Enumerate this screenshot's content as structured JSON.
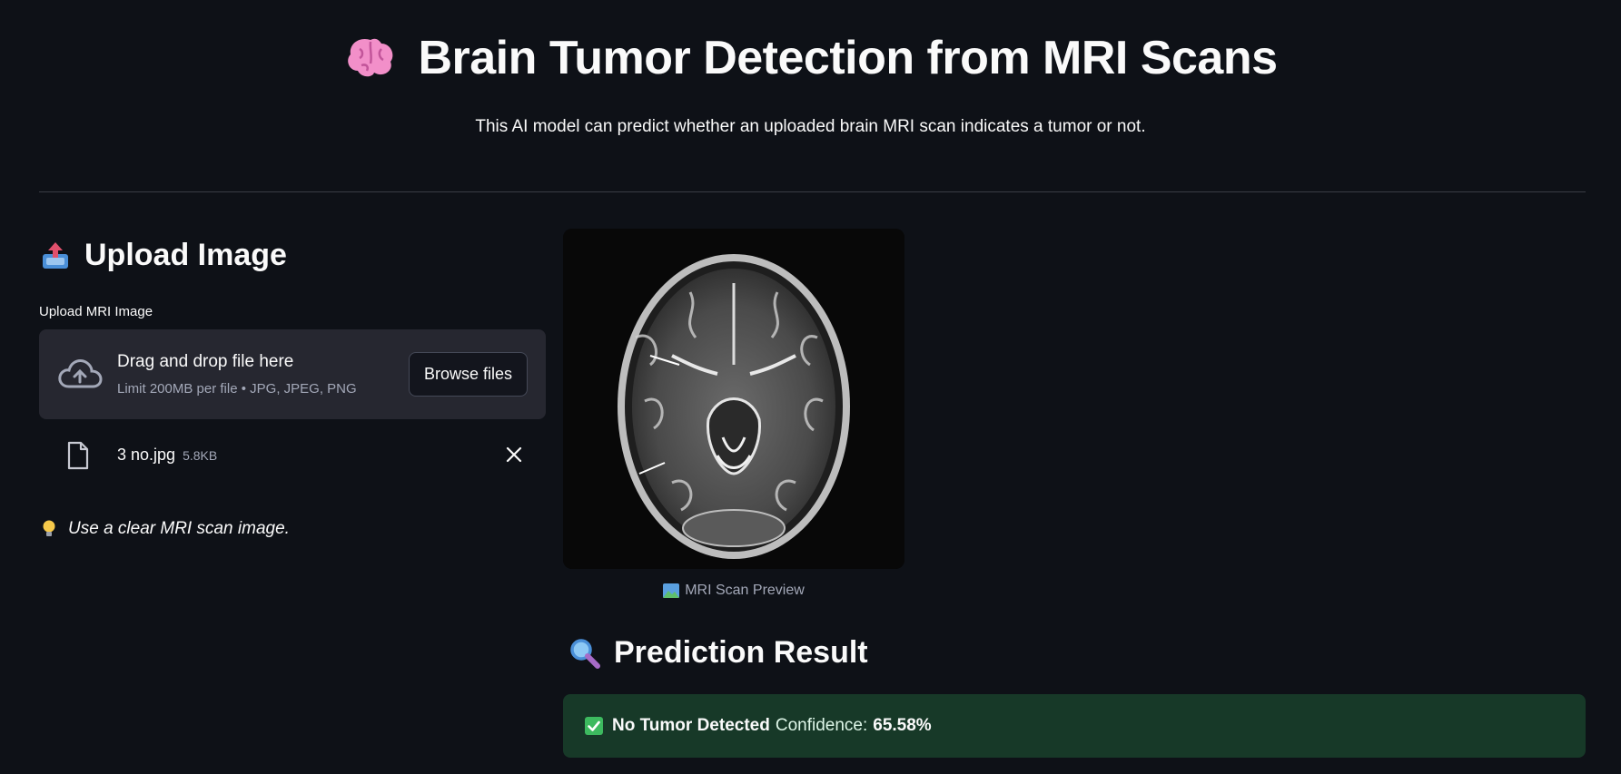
{
  "header": {
    "title": "Brain Tumor Detection from MRI Scans",
    "title_icon": "brain-emoji",
    "subtitle": "This AI model can predict whether an uploaded brain MRI scan indicates a tumor or not."
  },
  "upload": {
    "heading": "Upload Image",
    "heading_icon": "outbox-tray-emoji",
    "field_label": "Upload MRI Image",
    "dropzone_main": "Drag and drop file here",
    "dropzone_limit": "Limit 200MB per file • JPG, JPEG, PNG",
    "browse_label": "Browse files",
    "file": {
      "name": "3 no.jpg",
      "size": "5.8KB"
    },
    "tip": "Use a clear MRI scan image."
  },
  "preview": {
    "caption": "MRI Scan Preview"
  },
  "result": {
    "heading": "Prediction Result",
    "heading_icon": "magnifier-emoji",
    "status": "No Tumor Detected",
    "confidence_label": "Confidence:",
    "confidence_value": "65.58%"
  },
  "colors": {
    "background": "#0e1117",
    "dropzone": "#262730",
    "success_bg": "#173928",
    "accent_pink": "#f07ac8"
  }
}
